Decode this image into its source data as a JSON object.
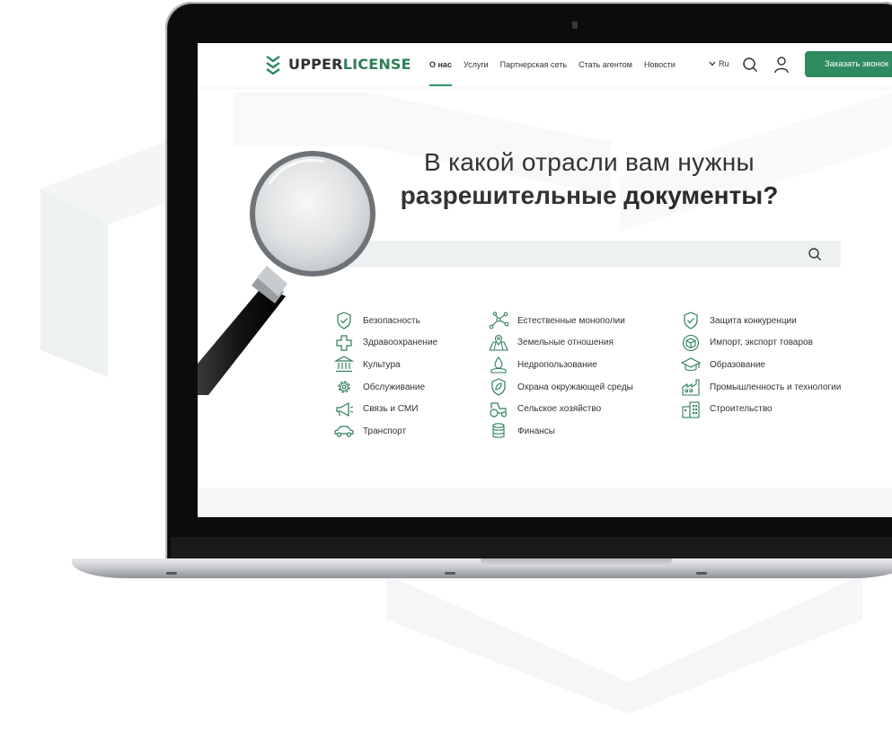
{
  "header": {
    "logo": {
      "text_main": "UPPER",
      "text_accent": "LICENSE"
    },
    "nav": [
      {
        "label": "О нас",
        "active": true
      },
      {
        "label": "Услуги"
      },
      {
        "label": "Партнерская сеть"
      },
      {
        "label": "Стать агентом"
      },
      {
        "label": "Новости"
      }
    ],
    "language": "Ru",
    "cta_label": "Заказать звонок"
  },
  "hero": {
    "line1": "В какой отрасли вам нужны",
    "line2_part1": "разрешительные ",
    "line2_part2": "документы?"
  },
  "search": {
    "placeholder": "",
    "value": ""
  },
  "categories": {
    "col1": [
      {
        "label": "Безопасность",
        "icon": "shield-check-icon"
      },
      {
        "label": "Здравоохранение",
        "icon": "medical-cross-icon"
      },
      {
        "label": "Культура",
        "icon": "museum-icon"
      },
      {
        "label": "Обслуживание",
        "icon": "gear-icon"
      },
      {
        "label": "Связь и СМИ",
        "icon": "megaphone-icon"
      },
      {
        "label": "Транспорт",
        "icon": "car-icon"
      }
    ],
    "col2": [
      {
        "label": "Естественные монополии",
        "icon": "network-icon"
      },
      {
        "label": "Земельные отношения",
        "icon": "map-pin-icon"
      },
      {
        "label": "Недропользование",
        "icon": "drill-icon"
      },
      {
        "label": "Охрана окружающей среды",
        "icon": "leaf-shield-icon"
      },
      {
        "label": "Сельское хозяйство",
        "icon": "tractor-icon"
      },
      {
        "label": "Финансы",
        "icon": "coins-icon"
      }
    ],
    "col3": [
      {
        "label": "Защита конкуренции",
        "icon": "shield-check-icon"
      },
      {
        "label": "Импорт, экспорт товаров",
        "icon": "package-icon"
      },
      {
        "label": "Образование",
        "icon": "graduation-cap-icon"
      },
      {
        "label": "Промышленность и технологии",
        "icon": "factory-icon"
      },
      {
        "label": "Строительство",
        "icon": "buildings-icon"
      }
    ]
  },
  "colors": {
    "accent": "#2e8b5f",
    "text": "#333333",
    "search_bg": "#eef1f2"
  }
}
